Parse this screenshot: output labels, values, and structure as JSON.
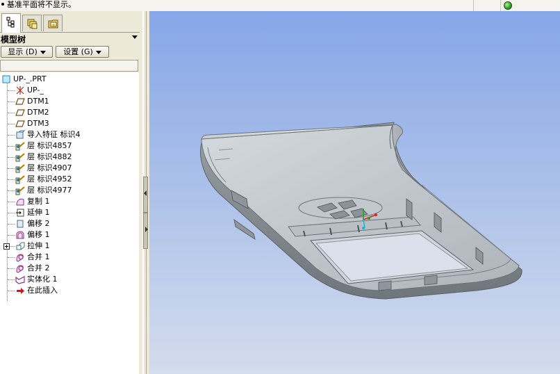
{
  "message_bar": {
    "text": "基准平面将不显示。"
  },
  "tabs": [
    {
      "icon": "model-tree-icon",
      "active": true
    },
    {
      "icon": "folder-browser-icon",
      "active": false
    },
    {
      "icon": "favorites-folder-icon",
      "active": false
    }
  ],
  "tree_header": {
    "title": "模型树"
  },
  "toolbar": {
    "show_label": "显示 (D)",
    "settings_label": "设置 (G)"
  },
  "tree": {
    "items": [
      {
        "label": "UP-_.PRT",
        "icon": "part-icon",
        "level": 0
      },
      {
        "label": "UP-_",
        "icon": "csys-icon",
        "level": 1
      },
      {
        "label": "DTM1",
        "icon": "datum-plane-icon",
        "level": 1
      },
      {
        "label": "DTM2",
        "icon": "datum-plane-icon",
        "level": 1
      },
      {
        "label": "DTM3",
        "icon": "datum-plane-icon",
        "level": 1
      },
      {
        "label": "导入特征 标识4",
        "icon": "import-feature-icon",
        "level": 1
      },
      {
        "label": "层 标识4857",
        "icon": "layer-icon",
        "level": 1
      },
      {
        "label": "层 标识4882",
        "icon": "layer-icon",
        "level": 1
      },
      {
        "label": "层 标识4907",
        "icon": "layer-icon",
        "level": 1
      },
      {
        "label": "层 标识4952",
        "icon": "layer-icon",
        "level": 1
      },
      {
        "label": "层 标识4977",
        "icon": "layer-icon",
        "level": 1
      },
      {
        "label": "复制 1",
        "icon": "copy-surface-icon",
        "level": 1
      },
      {
        "label": "延伸 1",
        "icon": "extend-icon",
        "level": 1
      },
      {
        "label": "偏移 2",
        "icon": "offset-icon",
        "level": 1
      },
      {
        "label": "偏移 1",
        "icon": "offset-surface-icon",
        "level": 1
      },
      {
        "label": "拉伸 1",
        "icon": "extrude-icon",
        "level": 1,
        "expandable": true
      },
      {
        "label": "合并 1",
        "icon": "merge-icon",
        "level": 1
      },
      {
        "label": "合并 2",
        "icon": "merge-icon",
        "level": 1
      },
      {
        "label": "实体化 1",
        "icon": "solidify-icon",
        "level": 1
      },
      {
        "label": "在此插入",
        "icon": "insert-here-arrow-icon",
        "level": 1
      }
    ]
  },
  "colors": {
    "viewport_top": "#86a6e8",
    "viewport_bottom": "#d3dced",
    "model_gray": "#a9b0b5",
    "panel_bg": "#ece9d8",
    "status_led": "#27a31a"
  }
}
